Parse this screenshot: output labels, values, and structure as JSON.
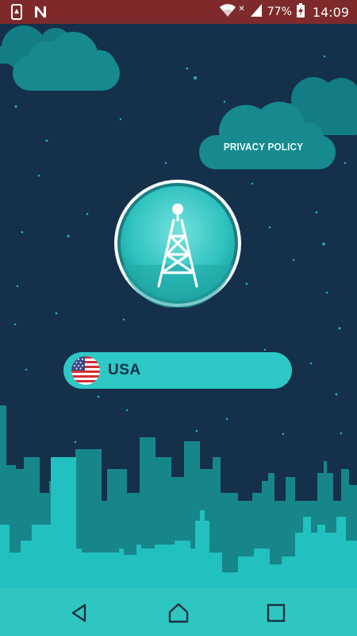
{
  "status_bar": {
    "battery_percent": "77%",
    "time": "14:09",
    "icons": [
      "usb-debug-icon",
      "n-app-icon",
      "wifi-icon",
      "no-sim-icon",
      "signal-icon",
      "battery-charging-icon"
    ]
  },
  "privacy_policy": {
    "label": "PRIVACY POLICY"
  },
  "connect_button": {
    "icon": "radio-tower-icon"
  },
  "country_selector": {
    "label": "USA",
    "flag": "us-flag-icon"
  },
  "nav_bar": {
    "icons": [
      "back-icon",
      "home-icon",
      "recents-icon"
    ]
  },
  "colors": {
    "background": "#15304a",
    "status_bar": "#7e2a2a",
    "accent": "#2ec8c6",
    "cloud": "#127d85",
    "city_far": "#17868b",
    "city_near": "#22c1bf"
  }
}
